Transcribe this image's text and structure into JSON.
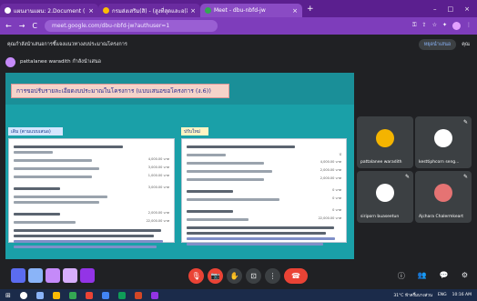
{
  "browser": {
    "tabs": [
      {
        "label": "แผนงานแผน: 2.Document (อัด",
        "close": "×"
      },
      {
        "label": "กรมส่งเสริม(สิ) - (สูงที่สุดและอ(สิท",
        "close": "×"
      },
      {
        "label": "Meet - dbu-nbfd-jw",
        "close": "×"
      }
    ],
    "new_tab": "+",
    "window_controls": [
      "–",
      "□",
      "×"
    ],
    "url": "meet.google.com/dbu-nbfd-jw?authuser=1",
    "nav": [
      "←",
      "→",
      "C"
    ]
  },
  "meet": {
    "header_text": "คุณกำลังนำเสนอการชี้แจงแนวทางงบประมาณโครงการ",
    "stop_button": "หยุดนำเสนอ",
    "you_label": "คุณ",
    "presenter_name": "pattalanee waradith กำลังนำเสนอ"
  },
  "slide": {
    "title": "การขอปรับรายละเอียดงบประมาณในโครงการ (แบบเสนอขอโครงการ (ง.6))",
    "left_label": "เดิม (ตามแบบเสนอ)",
    "right_label": "ปรับใหม่",
    "left_amounts": [
      "4,000.00 บาท",
      "3,000.00 บาท",
      "1,000.00 บาท",
      "3,000.00 บาท",
      "2,000.00 บาท",
      "22,000.00 บาท"
    ],
    "right_amounts": [
      "4,000.00 บาท",
      "2,000.00 บาท",
      "2,000.00 บาท",
      "0 บาท",
      "0 บาท",
      "0 บาท",
      "22,000.00 บาท"
    ],
    "cursor_hint": "ป"
  },
  "participants": [
    {
      "name": "pattalanee waradith",
      "color": "#f4b400"
    },
    {
      "name": "kesttiphcorn seng...",
      "color": "#ffffff"
    },
    {
      "name": "siriporn buaseetun",
      "color": "#ffffff"
    },
    {
      "name": "Ajchara Chalermkeart",
      "color": "#e57373"
    }
  ],
  "controls": {
    "mic": "🎙",
    "cam": "📷",
    "hand": "✋",
    "present": "⊡",
    "more": "⋮",
    "end": "☎",
    "info": "ⓘ",
    "people": "👥",
    "chat": "💬",
    "activities": "⚙"
  },
  "taskbar": {
    "start": "⊞",
    "weather": "31°C ฟ้าครึ้มบางส่วน",
    "time": "10:16 AM",
    "lang": "ENG"
  }
}
